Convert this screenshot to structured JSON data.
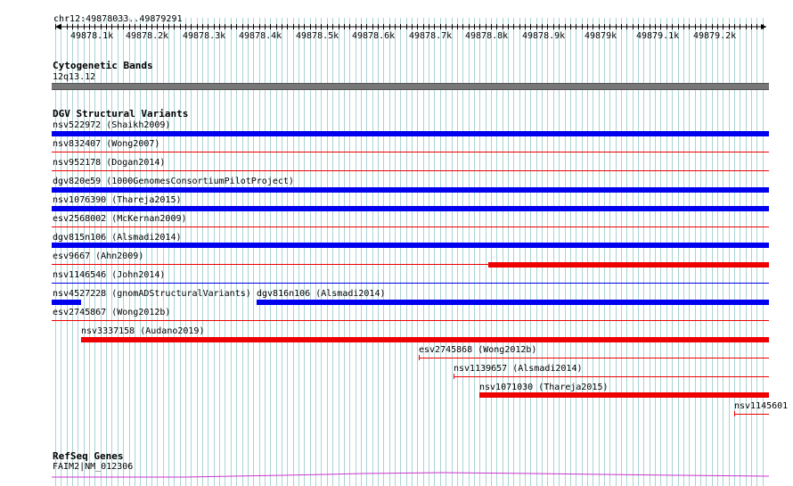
{
  "ruler": {
    "location": "chr12:49878033..49879291",
    "ticks": [
      "49878.1k",
      "49878.2k",
      "49878.3k",
      "49878.4k",
      "49878.5k",
      "49878.6k",
      "49878.7k",
      "49878.8k",
      "49878.9k",
      "49879k",
      "49879.1k",
      "49879.2k"
    ]
  },
  "cytoband": {
    "title": "Cytogenetic Bands",
    "label": "12q13.12"
  },
  "dgv": {
    "title": "DGV Structural Variants",
    "variants": [
      {
        "label": "nsv522972 (Shaikh2009)",
        "type": "loss"
      },
      {
        "label": "nsv832407 (Wong2007)",
        "type": "gain"
      },
      {
        "label": "nsv952178 (Dogan2014)",
        "type": "gain"
      },
      {
        "label": "dgv820e59 (1000GenomesConsortiumPilotProject)",
        "type": "loss"
      },
      {
        "label": "nsv1076390 (Thareja2015)",
        "type": "loss"
      },
      {
        "label": "esv2568002 (McKernan2009)",
        "type": "gain"
      },
      {
        "label": "dgv815n106 (Alsmadi2014)",
        "type": "loss"
      },
      {
        "label": "esv9667 (Ahn2009)",
        "type": "gain"
      },
      {
        "label": "nsv1146546 (John2014)",
        "type": "loss"
      },
      {
        "label": "nsv4527228 (gnomADStructuralVariants)",
        "type": "loss"
      },
      {
        "label": "dgv816n106 (Alsmadi2014)",
        "type": "loss"
      },
      {
        "label": "esv2745867 (Wong2012b)",
        "type": "gain"
      },
      {
        "label": "nsv3337158 (Audano2019)",
        "type": "gain"
      },
      {
        "label": "esv2745868 (Wong2012b)",
        "type": "gain"
      },
      {
        "label": "nsv1139657 (Alsmadi2014)",
        "type": "gain"
      },
      {
        "label": "nsv1071030 (Thareja2015)",
        "type": "gain"
      },
      {
        "label": "nsv1145601",
        "type": "gain"
      }
    ]
  },
  "refseq": {
    "title": "RefSeq Genes",
    "gene_label": "FAIM2|NM_012306"
  },
  "colors": {
    "loss": "#0000ee",
    "gain": "#ee0000",
    "grid": "#a9d3d6",
    "gene": "#cc33cc",
    "band": "#777777"
  }
}
